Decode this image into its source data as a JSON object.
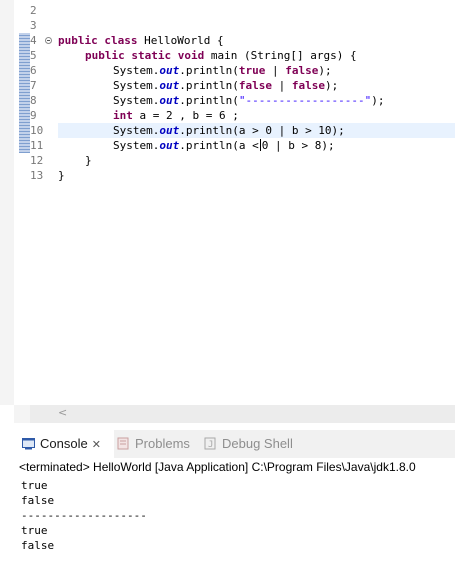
{
  "editor": {
    "line_numbers": [
      "2",
      "3",
      "4",
      "5",
      "6",
      "7",
      "8",
      "9",
      "10",
      "11",
      "12",
      "13"
    ],
    "code": {
      "l3": {
        "kw1": "public",
        "kw2": "class",
        "rest": " HelloWorld {"
      },
      "l4": {
        "kw1": "public",
        "kw2": "static",
        "kw3": "void",
        "rest": " main (String[] args) {"
      },
      "l5": {
        "pre": "System.",
        "out": "out",
        "mid": ".println(",
        "kw": "true",
        "mid2": " | ",
        "kw2": "false",
        "end": ");"
      },
      "l6": {
        "pre": "System.",
        "out": "out",
        "mid": ".println(",
        "kw": "false",
        "mid2": " | ",
        "kw2": "false",
        "end": ");"
      },
      "l7": {
        "pre": "System.",
        "out": "out",
        "mid": ".println(",
        "str": "\"------------------\"",
        "end": ");"
      },
      "l8": {
        "kw": "int",
        "rest": " a = 2 , b = 6 ;"
      },
      "l9": {
        "pre": "System.",
        "out": "out",
        "mid": ".println(a > 0 | b > 10);"
      },
      "l10": {
        "pre": "System.",
        "out": "out",
        "mid": ".println(a <",
        "end": "0 | b > 8);"
      },
      "l11": {
        "text": "}"
      },
      "l12": {
        "text": "}"
      }
    }
  },
  "console": {
    "tabs": [
      {
        "label": "Console",
        "icon": "console-icon",
        "closable": true
      },
      {
        "label": "Problems",
        "icon": "problems-icon"
      },
      {
        "label": "Debug Shell",
        "icon": "debug-shell-icon"
      }
    ],
    "status": "<terminated> HelloWorld [Java Application] C:\\Program Files\\Java\\jdk1.8.0",
    "output": [
      "true",
      "false",
      "-------------------",
      "true",
      "false"
    ]
  }
}
